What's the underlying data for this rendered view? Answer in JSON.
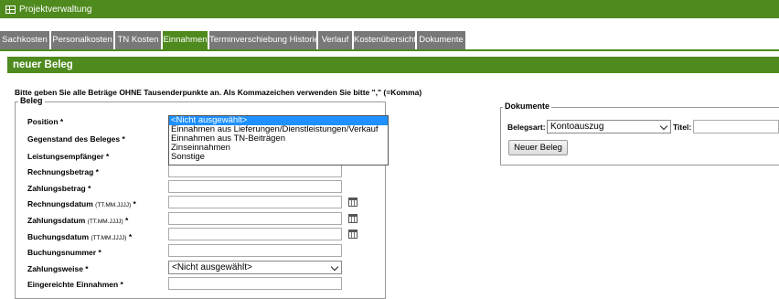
{
  "window": {
    "title": "Projektverwaltung"
  },
  "tabs": [
    {
      "label": "Sachkosten",
      "active": false
    },
    {
      "label": "Personalkosten",
      "active": false
    },
    {
      "label": "TN Kosten",
      "active": false
    },
    {
      "label": "Einnahmen",
      "active": true
    },
    {
      "label": "Terminverschiebung Historie",
      "active": false
    },
    {
      "label": "Verlauf",
      "active": false
    },
    {
      "label": "Kostenübersicht",
      "active": false
    },
    {
      "label": "Dokumente",
      "active": false
    }
  ],
  "section": {
    "title": "neuer Beleg"
  },
  "instruction": "Bitte geben Sie alle Beträge OHNE Tausenderpunkte an. Als Kommazeichen verwenden Sie bitte \",\" (=Komma)",
  "beleg": {
    "legend": "Beleg",
    "fields": {
      "position": "Position *",
      "gegenstand": "Gegenstand des Beleges *",
      "leistung": "Leistungsempfänger *",
      "rechnungsbetrag": "Rechnungsbetrag *",
      "zahlungsbetrag": "Zahlungsbetrag *",
      "rechnungsdatum": "Rechnungsdatum",
      "zahlungsdatum": "Zahlungsdatum",
      "buchungsdatum": "Buchungsdatum",
      "date_hint": "(TT.MM.JJJJ)",
      "required": "*",
      "buchungsnummer": "Buchungsnummer *",
      "zahlungsweise": "Zahlungsweise *",
      "eingereicht": "Eingereichte Einnahmen *"
    },
    "position_dropdown": {
      "options": [
        "<Nicht ausgewählt>",
        "Einnahmen aus Lieferungen/Dienstleistungen/Verkauf",
        "Einnahmen aus TN-Beiträgen",
        "Zinseinnahmen",
        "Sonstige"
      ],
      "selected_index": 0
    },
    "zahlungsweise_value": "<Nicht ausgewählt>"
  },
  "dokumente": {
    "legend": "Dokumente",
    "belegart_label": "Belegsart:",
    "belegart_value": "Kontoauszug",
    "titel_label": "Titel:",
    "new_button": "Neuer Beleg"
  },
  "colors": {
    "brand_green": "#4e8a1e",
    "tab_gray": "#787878",
    "highlight": "#1e90ff"
  }
}
